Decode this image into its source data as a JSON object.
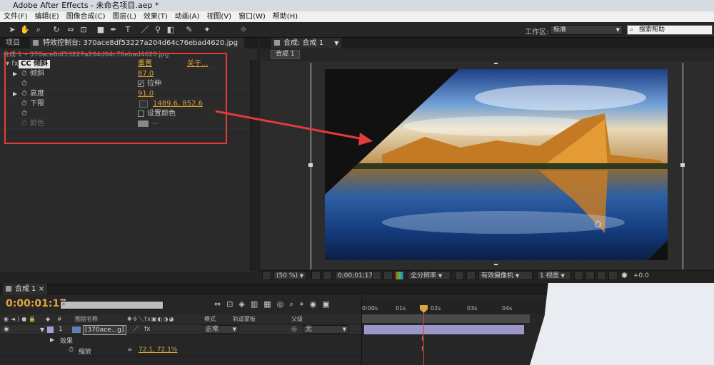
{
  "window": {
    "title": "Adobe After Effects - 未命名项目.aep *",
    "logo_text": "Ae"
  },
  "menu": [
    "文件(F)",
    "编辑(E)",
    "图像合成(C)",
    "图层(L)",
    "效果(T)",
    "动画(A)",
    "视图(V)",
    "窗口(W)",
    "帮助(H)"
  ],
  "toolbar": {
    "workspace_label": "工作区:",
    "workspace_value": "标准",
    "search_placeholder": "搜索帮助"
  },
  "left_panel": {
    "tab_project": "项目",
    "tab_effects": "特效控制台: 370ace8df53227a204d64c76ebad4620.jpg",
    "subtitle": "合成 1 • 370ace8df53227a204d64c76ebad4620.jpg",
    "effect_name": "CC 倾斜",
    "reset": "重置",
    "about": "关于...",
    "props": {
      "skew_label": "倾斜",
      "skew_value": "87.0",
      "stretch_label": "拉伸",
      "height_label": "高度",
      "height_value": "91.0",
      "bottom_label": "下限",
      "bottom_value": "1489.6, 852.6",
      "set_color_label": "设置颜色",
      "color_label": "颜色"
    }
  },
  "right_panel": {
    "tab_comp": "合成: 合成 1",
    "crumb": "合成 1",
    "controls": {
      "zoom": "(50 %)",
      "timecode": "0;00;01;17",
      "resolution": "全分辨率",
      "camera": "有效摄像机",
      "views": "1 视图",
      "exposure": "+0.0"
    }
  },
  "timeline": {
    "tab": "合成 1",
    "timecode": "0:00:01:17",
    "headers": {
      "num": "#",
      "layer_name": "图层名称",
      "mode": "模式",
      "trkmat": "轨道蒙板",
      "parent": "父级"
    },
    "layer": {
      "index": "1",
      "name": "[370ace...g]",
      "mode": "正常",
      "parent": "无"
    },
    "effects_label": "效果",
    "scale_label": "缩放",
    "scale_value": "72.1, 72.1%",
    "ruler_ticks": [
      "0:00s",
      "01s",
      "02s",
      "03s",
      "04s"
    ]
  }
}
